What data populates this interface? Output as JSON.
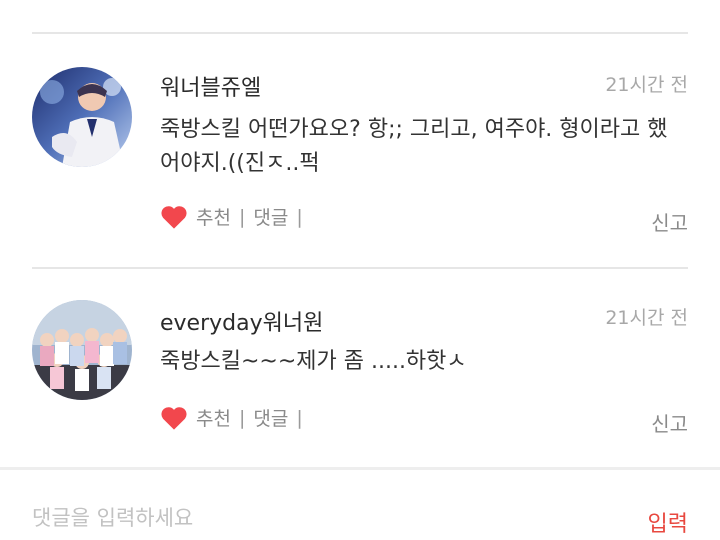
{
  "comments": [
    {
      "username": "워너블쥬엘",
      "time": "21시간 전",
      "text": "죽방스킬 어떤가요오? 항;; 그리고, 여주야. 형이라고 했어야지.((진ㅈ..퍽",
      "like_label": "추천",
      "separator": "|",
      "reply_label": "댓글",
      "trailing_separator": "|",
      "report_label": "신고",
      "avatar_icon": "profile-photo",
      "heart_color": "#f2474d"
    },
    {
      "username": "everyday워너원",
      "time": "21시간 전",
      "text": "죽방스킬~~~제가 좀 .....하핫ㅅ",
      "like_label": "추천",
      "separator": "|",
      "reply_label": "댓글",
      "trailing_separator": "|",
      "report_label": "신고",
      "avatar_icon": "group-photo",
      "heart_color": "#f2474d"
    }
  ],
  "input": {
    "placeholder": "댓글을 입력하세요",
    "value": "",
    "submit_label": "입력",
    "submit_color": "#e8483f"
  }
}
